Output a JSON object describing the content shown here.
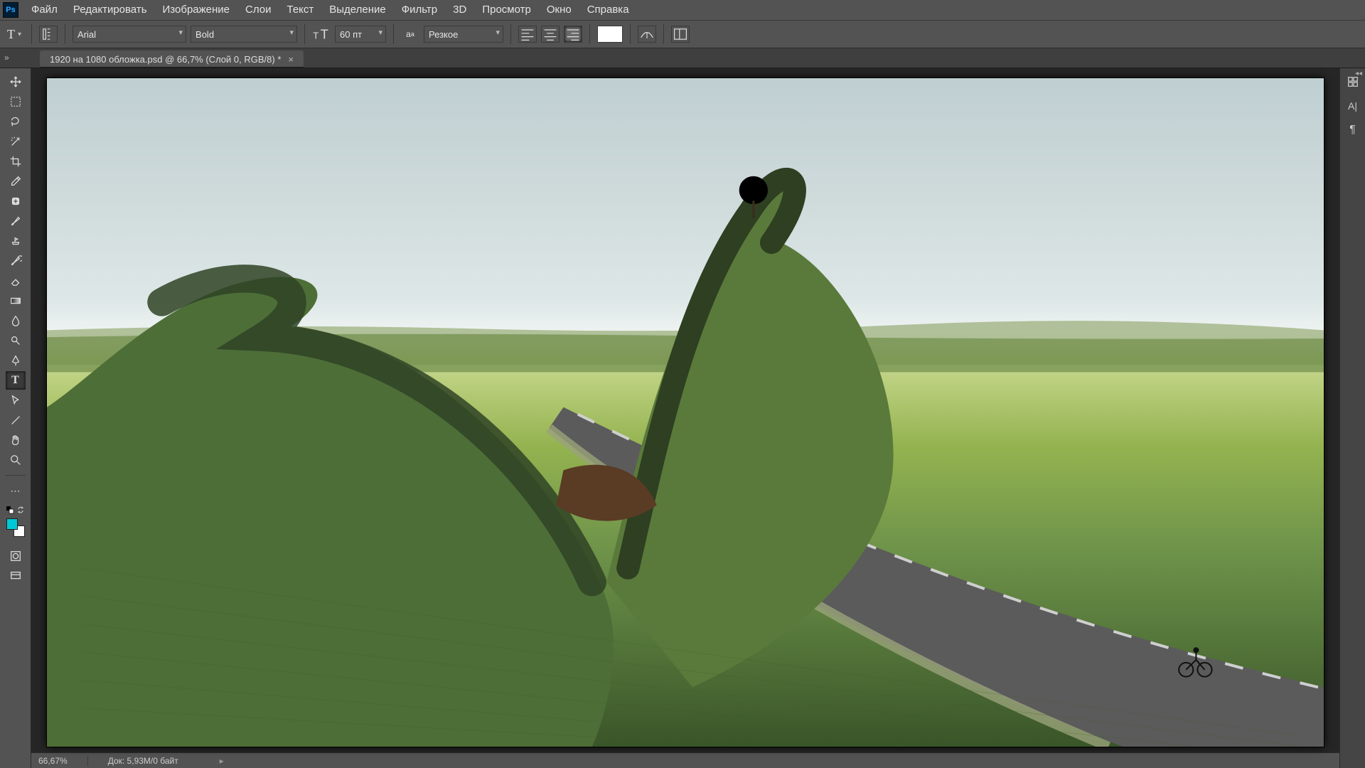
{
  "menu": {
    "items": [
      "Файл",
      "Редактировать",
      "Изображение",
      "Слои",
      "Текст",
      "Выделение",
      "Фильтр",
      "3D",
      "Просмотр",
      "Окно",
      "Справка"
    ]
  },
  "options": {
    "tool_letter": "T",
    "font_family": "Arial",
    "font_weight": "Bold",
    "font_size": "60 пт",
    "antialias": "Резкое"
  },
  "document": {
    "tab_title": "1920 на 1080 обложка.psd @ 66,7% (Слой 0, RGB/8) *"
  },
  "status": {
    "zoom": "66,67%",
    "doc_info": "Док: 5,93M/0 байт"
  },
  "colors": {
    "foreground": "#00c8d7",
    "background": "#ffffff",
    "text_swatch": "#ffffff"
  },
  "tools": {
    "list": [
      "move",
      "marquee",
      "lasso",
      "magic-wand",
      "crop",
      "eyedropper",
      "healing-brush",
      "brush",
      "clone-stamp",
      "history-brush",
      "eraser",
      "gradient",
      "blur",
      "dodge",
      "pen",
      "type",
      "path-select",
      "line",
      "hand",
      "zoom"
    ],
    "active": "type"
  },
  "right_dock": [
    "swatches",
    "character",
    "paragraph"
  ]
}
